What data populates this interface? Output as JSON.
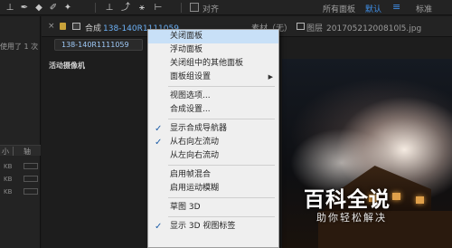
{
  "toolbar": {
    "align_label": "对齐",
    "workspace_all_panels": "所有面板",
    "workspace_default": "默认",
    "workspace_menu_icon": "≡",
    "workspace_standard": "标准"
  },
  "left_panel": {
    "truncated_text": "使用了 1 次",
    "col_small": "小",
    "col_axis": "轴",
    "unit_label": "KB"
  },
  "comp_panel": {
    "tabs": {
      "close_glyph": "×",
      "comp_label": "合成",
      "comp_name": "138-140R1111059",
      "footage_label": "素材（无）",
      "layer_label": "图层",
      "layer_file": "20170521200810l5.jpg"
    },
    "breadcrumb": "138-140R1111059",
    "camera_label": "活动摄像机"
  },
  "context_menu": {
    "items": [
      {
        "label": "关闭面板",
        "checked": false,
        "submenu": false
      },
      {
        "label": "浮动面板",
        "checked": false,
        "submenu": false
      },
      {
        "label": "关闭组中的其他面板",
        "checked": false,
        "submenu": false
      },
      {
        "label": "面板组设置",
        "checked": false,
        "submenu": true
      },
      {
        "label": "视图选项...",
        "checked": false,
        "submenu": false
      },
      {
        "label": "合成设置...",
        "checked": false,
        "submenu": false
      },
      {
        "label": "显示合成导航器",
        "checked": true,
        "submenu": false
      },
      {
        "label": "从右向左流动",
        "checked": true,
        "submenu": false
      },
      {
        "label": "从左向右流动",
        "checked": false,
        "submenu": false
      },
      {
        "label": "启用帧混合",
        "checked": false,
        "submenu": false
      },
      {
        "label": "启用运动模糊",
        "checked": false,
        "submenu": false
      },
      {
        "label": "草图 3D",
        "checked": false,
        "submenu": false
      },
      {
        "label": "显示 3D 视图标签",
        "checked": true,
        "submenu": false
      }
    ],
    "check_glyph": "✓",
    "arrow_glyph": "▶"
  },
  "watermark": {
    "main": "百科全说",
    "sub": "助你轻松解决"
  },
  "colors": {
    "accent_blue": "#3f8fe8",
    "comp_name_blue": "#6cb0f5",
    "menu_bg": "#efefef",
    "menu_highlight": "#c8e0f7",
    "ui_dark": "#232323"
  },
  "icons": {
    "toolbar": [
      "puppet-tool-icon",
      "pen-tool-icon",
      "eraser-tool-icon",
      "roto-brush-icon",
      "puppet-pin-icon",
      "camera-orbit-icon",
      "camera-track-icon",
      "3d-axis-icon"
    ]
  }
}
